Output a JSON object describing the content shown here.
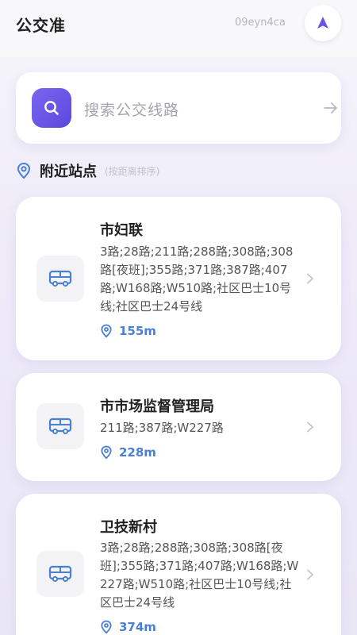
{
  "header": {
    "title": "公交准",
    "user_id": "09eyn4ca"
  },
  "search": {
    "placeholder": "搜索公交线路"
  },
  "section": {
    "title": "附近站点",
    "subtitle": "(按距离排序)"
  },
  "stops": [
    {
      "name": "市妇联",
      "routes": "3路;28路;211路;288路;308路;308路[夜班];355路;371路;387路;407路;W168路;W510路;社区巴士10号线;社区巴士24号线",
      "distance": "155m"
    },
    {
      "name": "市市场监督管理局",
      "routes": "211路;387路;W227路",
      "distance": "228m"
    },
    {
      "name": "卫技新村",
      "routes": "3路;28路;288路;308路;308路[夜班];355路;371路;407路;W168路;W227路;W510路;社区巴士10号线;社区巴士24号线",
      "distance": "374m"
    }
  ],
  "colors": {
    "accent": "#6653e8",
    "distance": "#4a7fd1",
    "bus_icon": "#4a7fd1"
  },
  "icons": {
    "nav": "navigation-arrow-icon",
    "search": "search-icon",
    "arrow": "arrow-right-icon",
    "location": "location-pin-icon",
    "bus": "bus-icon",
    "chevron": "chevron-right-icon"
  }
}
